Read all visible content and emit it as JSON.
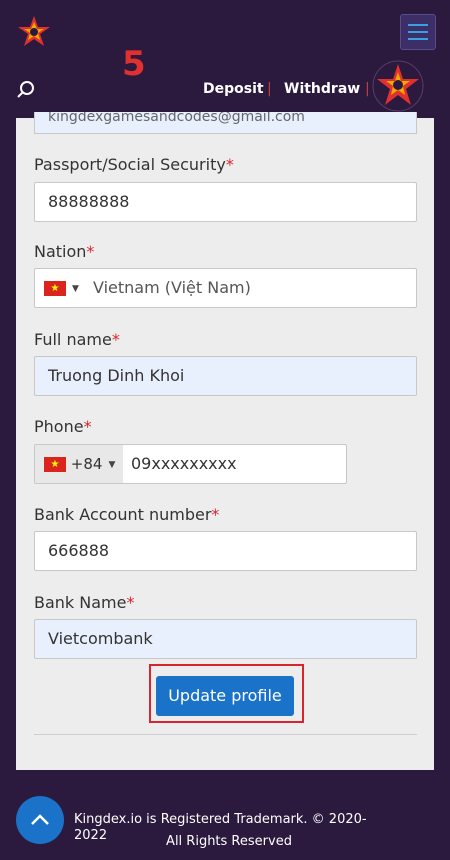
{
  "header": {
    "step_number": "5",
    "nav": {
      "deposit": "Deposit",
      "separator": "|",
      "withdraw": "Withdraw"
    },
    "icons": {
      "logo": "kingdex-star-logo",
      "search": "search-icon",
      "menu": "hamburger-menu-icon"
    }
  },
  "form": {
    "email_partial": "kingdexgamesandcodes@gmail.com",
    "fields": [
      {
        "label": "Passport/Social Security",
        "required": "*",
        "value": "88888888"
      },
      {
        "label": "Nation",
        "required": "*",
        "value": "Vietnam (Việt Nam)"
      },
      {
        "label": "Full name",
        "required": "*",
        "value": "Truong Dinh Khoi"
      },
      {
        "label": "Phone",
        "required": "*",
        "country_code": "+84",
        "value": "09xxxxxxxxx"
      },
      {
        "label": "Bank Account number",
        "required": "*",
        "value": "666888"
      },
      {
        "label": "Bank Name",
        "required": "*",
        "value": "Vietcombank"
      }
    ],
    "submit_label": "Update profile"
  },
  "footer": {
    "line1": "Kingdex.io is Registered Trademark. © 2020-2022",
    "line2": "All Rights Reserved"
  },
  "colors": {
    "background": "#2b1a3d",
    "primary": "#1a73c9",
    "required": "#d9262e"
  }
}
